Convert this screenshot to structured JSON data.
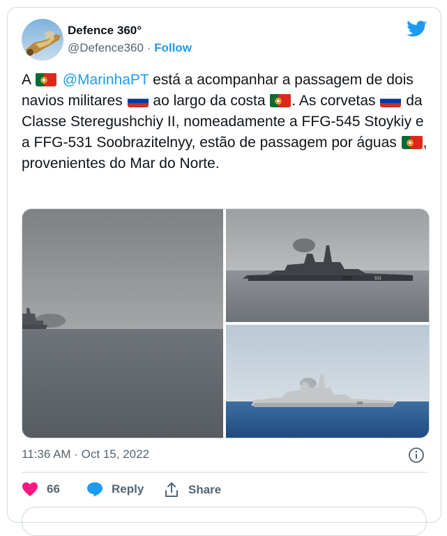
{
  "author": {
    "name": "Defence 360°",
    "handle": "@Defence360",
    "separator": "·",
    "follow_label": "Follow"
  },
  "tweet": {
    "t1": "A ",
    "mention": "@MarinhaPT",
    "t2": " está a acompanhar a passagem de dois navios militares ",
    "t3": " ao largo da costa ",
    "t4": ". As corvetas ",
    "t5": " da Classe Steregushchiy II, nomeadamente a FFG-545 Stoykiy e a FFG-531 Soobrazitelnyy, estão de passagem por águas ",
    "t6": ", provenientes do Mar do Norte."
  },
  "media": {
    "ship1_hull": "531",
    "ship2_hull": "545"
  },
  "timestamp": "11:36 AM · Oct 15, 2022",
  "actions": {
    "likes_count": "66",
    "reply_label": "Reply",
    "share_label": "Share"
  },
  "colors": {
    "accent": "#1d9bf0",
    "like": "#f91880",
    "text_secondary": "#536471",
    "border": "#cfd9de"
  },
  "icons": [
    "avatar",
    "twitter-bird-icon",
    "portugal-flag-icon",
    "russia-flag-icon",
    "info-icon",
    "heart-icon",
    "reply-icon",
    "share-icon"
  ]
}
